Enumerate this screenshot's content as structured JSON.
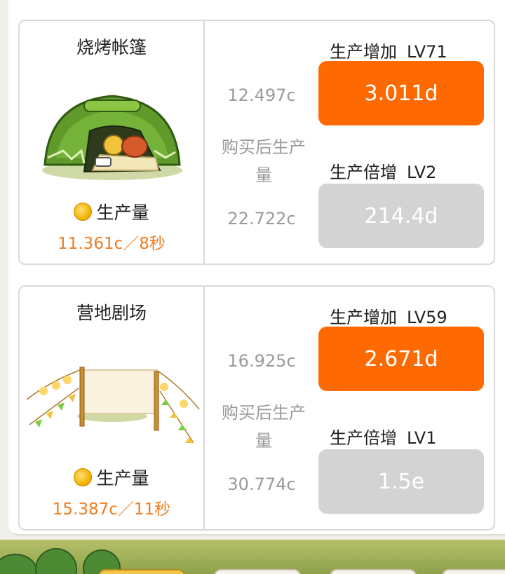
{
  "buildings": [
    {
      "name": "烧烤帐篷",
      "production_label": "生产量",
      "production_value": "11.361c／8秒",
      "current_output": "12.497c",
      "after_purchase_label": "购买后生产量",
      "next_output": "22.722c",
      "upgrade1_label": "生产增加",
      "upgrade1_level": "LV71",
      "upgrade1_price": "3.011d",
      "upgrade2_label": "生产倍增",
      "upgrade2_level": "LV2",
      "upgrade2_price": "214.4d"
    },
    {
      "name": "营地剧场",
      "production_label": "生产量",
      "production_value": "15.387c／11秒",
      "current_output": "16.925c",
      "after_purchase_label": "购买后生产量",
      "next_output": "30.774c",
      "upgrade1_label": "生产增加",
      "upgrade1_level": "LV59",
      "upgrade1_price": "2.671d",
      "upgrade2_label": "生产倍增",
      "upgrade2_level": "LV1",
      "upgrade2_price": "1.5e"
    }
  ],
  "colors": {
    "accent_orange": "#ff6a00",
    "disabled_gray": "#d3d3d3",
    "production_text": "#f07c1e",
    "muted_text": "#9a9a9a"
  },
  "icons": {
    "coin": "coin-icon",
    "tent": "tent-illustration",
    "stage": "stage-illustration"
  }
}
